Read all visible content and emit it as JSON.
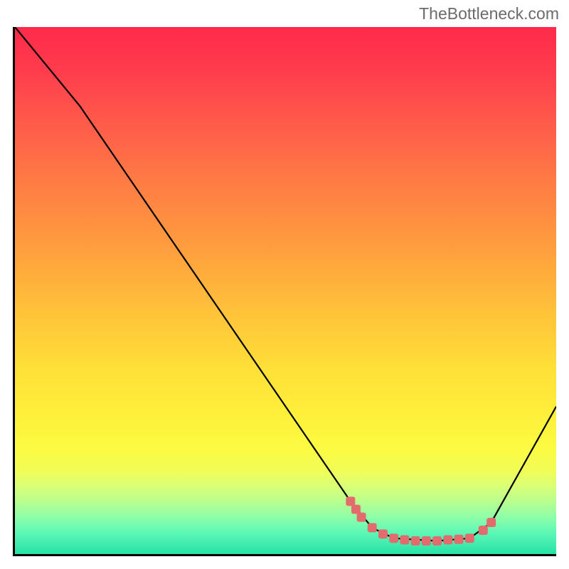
{
  "watermark": "TheBottleneck.com",
  "chart_data": {
    "type": "line",
    "title": "",
    "xlabel": "",
    "ylabel": "",
    "xlim": [
      0,
      100
    ],
    "ylim": [
      0,
      100
    ],
    "series": [
      {
        "name": "bottleneck-curve",
        "points": [
          {
            "x": 0,
            "y": 100
          },
          {
            "x": 12,
            "y": 85
          },
          {
            "x": 62,
            "y": 10
          },
          {
            "x": 66,
            "y": 5
          },
          {
            "x": 70,
            "y": 3
          },
          {
            "x": 78,
            "y": 2.5
          },
          {
            "x": 84,
            "y": 3
          },
          {
            "x": 88,
            "y": 6
          },
          {
            "x": 100,
            "y": 28
          }
        ]
      }
    ],
    "markers": {
      "name": "highlight-segment",
      "color": "#e36a6d",
      "points": [
        {
          "x": 62,
          "y": 10
        },
        {
          "x": 63,
          "y": 8.5
        },
        {
          "x": 64,
          "y": 7
        },
        {
          "x": 66,
          "y": 5
        },
        {
          "x": 68,
          "y": 3.8
        },
        {
          "x": 70,
          "y": 3
        },
        {
          "x": 72,
          "y": 2.7
        },
        {
          "x": 74,
          "y": 2.5
        },
        {
          "x": 76,
          "y": 2.5
        },
        {
          "x": 78,
          "y": 2.5
        },
        {
          "x": 80,
          "y": 2.7
        },
        {
          "x": 82,
          "y": 2.8
        },
        {
          "x": 84,
          "y": 3
        },
        {
          "x": 86.5,
          "y": 4.5
        },
        {
          "x": 88,
          "y": 6
        }
      ]
    },
    "gradient_stops": [
      {
        "pos": 0,
        "color": "#ff2a4a"
      },
      {
        "pos": 0.5,
        "color": "#ffe038"
      },
      {
        "pos": 1,
        "color": "#26e2a5"
      }
    ]
  }
}
